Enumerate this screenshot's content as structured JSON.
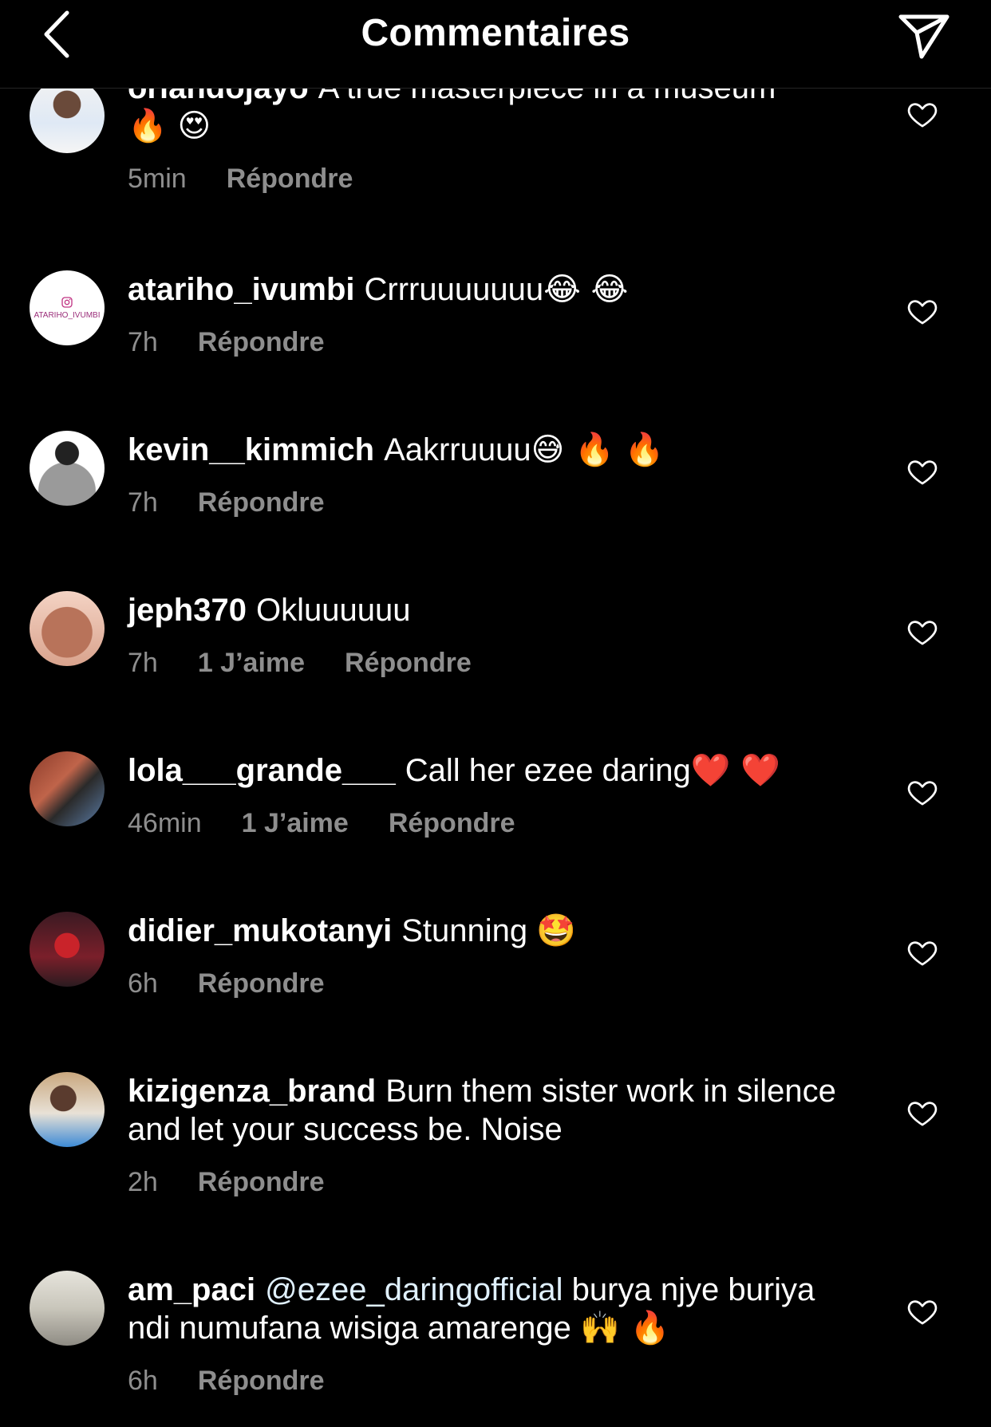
{
  "header": {
    "title": "Commentaires"
  },
  "comments": [
    {
      "username": "orlandojayo",
      "text": "A true masterpiece in a museum",
      "emojis": "🔥 😍",
      "time": "5min",
      "likes": "",
      "reply": "Répondre"
    },
    {
      "username": "atariho_ivumbi",
      "text": "Crrruuuuuuu",
      "emojis": "😂 😂",
      "time": "7h",
      "likes": "",
      "reply": "Répondre",
      "avatar_text": "ATARIHO_IVUMBI"
    },
    {
      "username": "kevin__kimmich",
      "text": "Aakrruuuu",
      "emojis": "😅 🔥 🔥",
      "time": "7h",
      "likes": "",
      "reply": "Répondre"
    },
    {
      "username": "jeph370",
      "text": "Okluuuuuu",
      "emojis": "",
      "time": "7h",
      "likes": "1 J’aime",
      "reply": "Répondre"
    },
    {
      "username": "lola___grande___",
      "text": "Call her ezee daring",
      "emojis": "❤️ ❤️",
      "time": "46min",
      "likes": "1 J’aime",
      "reply": "Répondre"
    },
    {
      "username": "didier_mukotanyi",
      "text": "Stunning",
      "emojis": "🤩",
      "time": "6h",
      "likes": "",
      "reply": "Répondre"
    },
    {
      "username": "kizigenza_brand",
      "text": "Burn them sister work in silence and let your success be. Noise",
      "emojis": "",
      "time": "2h",
      "likes": "",
      "reply": "Répondre"
    },
    {
      "username": "am_paci",
      "mention": "@ezee_daringofficial",
      "text": "burya njye buriya ndi numufana wisiga amarenge",
      "emojis": "🙌 🔥",
      "time": "6h",
      "likes": "",
      "reply": "Répondre"
    }
  ],
  "colors": {
    "background": "#000000",
    "text": "#ffffff",
    "secondary": "#8e8e8e",
    "mention": "#e0f1ff"
  }
}
